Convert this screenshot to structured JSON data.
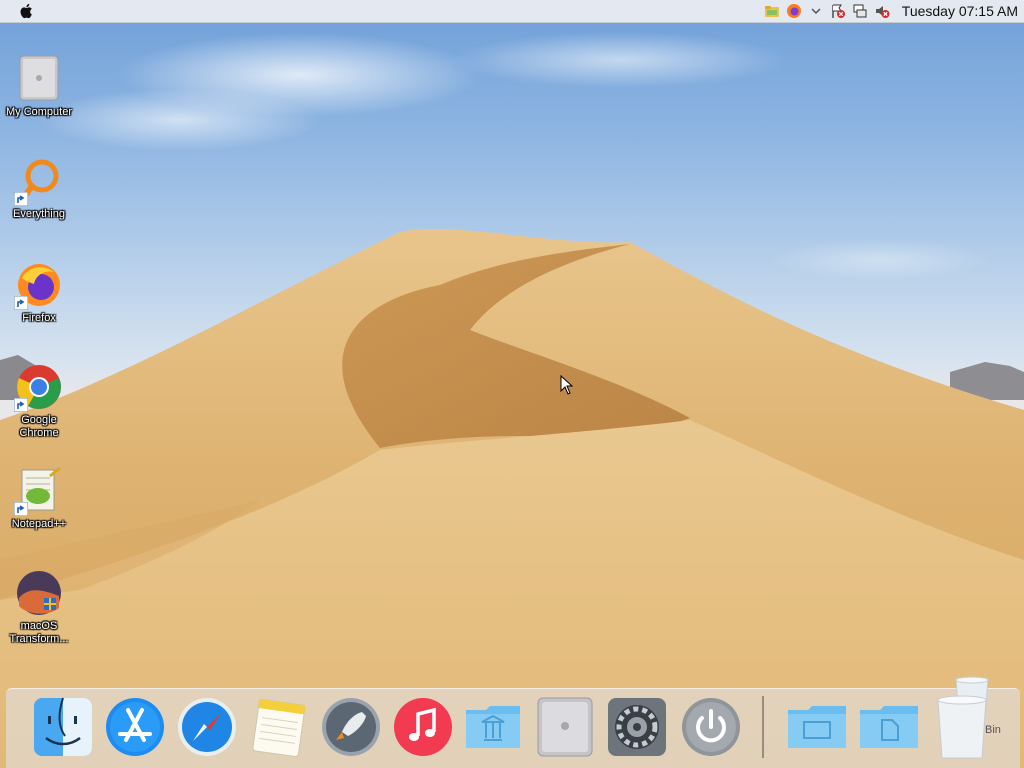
{
  "menubar": {
    "apple_icon": "apple-icon",
    "tray": [
      "folder-icon",
      "firefox-icon",
      "chevron-down-icon",
      "flag-error-icon",
      "network-icon",
      "volume-muted-icon"
    ],
    "clock": "Tuesday 07:15 AM"
  },
  "desktop_icons": [
    {
      "label": "My Computer",
      "icon": "computer-icon"
    },
    {
      "label": "Everything",
      "icon": "everything-icon"
    },
    {
      "label": "Firefox",
      "icon": "firefox-icon"
    },
    {
      "label": "Google Chrome",
      "label_lines": [
        "Google",
        "Chrome"
      ],
      "icon": "chrome-icon"
    },
    {
      "label": "Notepad++",
      "icon": "notepadpp-icon"
    },
    {
      "label": "macOS Transform...",
      "label_lines": [
        "macOS",
        "Transform..."
      ],
      "icon": "macos-transformation-icon"
    }
  ],
  "dock": {
    "items": [
      "finder-icon",
      "app-store-icon",
      "safari-icon",
      "notes-icon",
      "launchpad-icon",
      "music-icon",
      "applications-folder-icon",
      "computer-icon",
      "system-preferences-icon",
      "power-icon",
      "desktop-folder-icon",
      "documents-folder-icon",
      "trash-icon"
    ],
    "trash_label": "Bin"
  },
  "colors": {
    "sky": "#8fb6e2",
    "sand": "#d9a866",
    "dock": "#e1e6ee"
  }
}
